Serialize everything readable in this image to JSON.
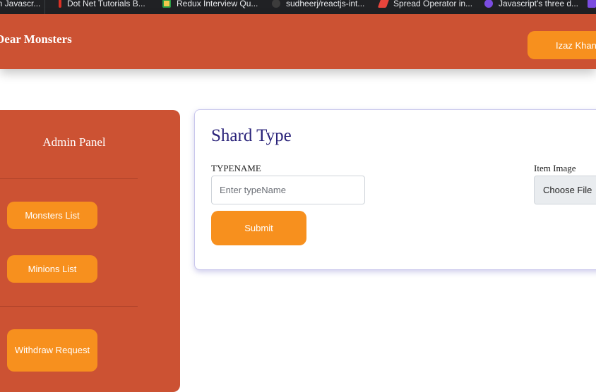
{
  "bookmarks": [
    {
      "label": "ern Javascr...",
      "icon": "page-icon",
      "color": "#5f6368"
    },
    {
      "label": "Dot Net Tutorials B...",
      "icon": "dotnet-icon",
      "color": "#d93025"
    },
    {
      "label": "Redux Interview Qu...",
      "icon": "redux-icon",
      "color": "#f2c94c"
    },
    {
      "label": "sudheerj/reactjs-int...",
      "icon": "github-icon",
      "color": "#3c3c3c"
    },
    {
      "label": "Spread Operator in...",
      "icon": "spread-icon",
      "color": "#e8453c"
    },
    {
      "label": "Javascript's three d...",
      "icon": "js-icon",
      "color": "#7b4ce0"
    }
  ],
  "header": {
    "brand": "Dear Monsters",
    "user_name": "Izaz Khan"
  },
  "sidebar": {
    "title": "Admin Panel",
    "items": [
      {
        "label": "Monsters List"
      },
      {
        "label": "Minions List"
      },
      {
        "label": "Withdraw Request"
      }
    ]
  },
  "form": {
    "title": "Shard Type",
    "typename_label": "TYPENAME",
    "typename_placeholder": "Enter typeName",
    "typename_value": "",
    "image_label": "Item Image",
    "file_button": "Choose File",
    "submit_label": "Submit"
  },
  "colors": {
    "brand": "#cc5233",
    "accent": "#f7901e",
    "title": "#2a237a"
  }
}
